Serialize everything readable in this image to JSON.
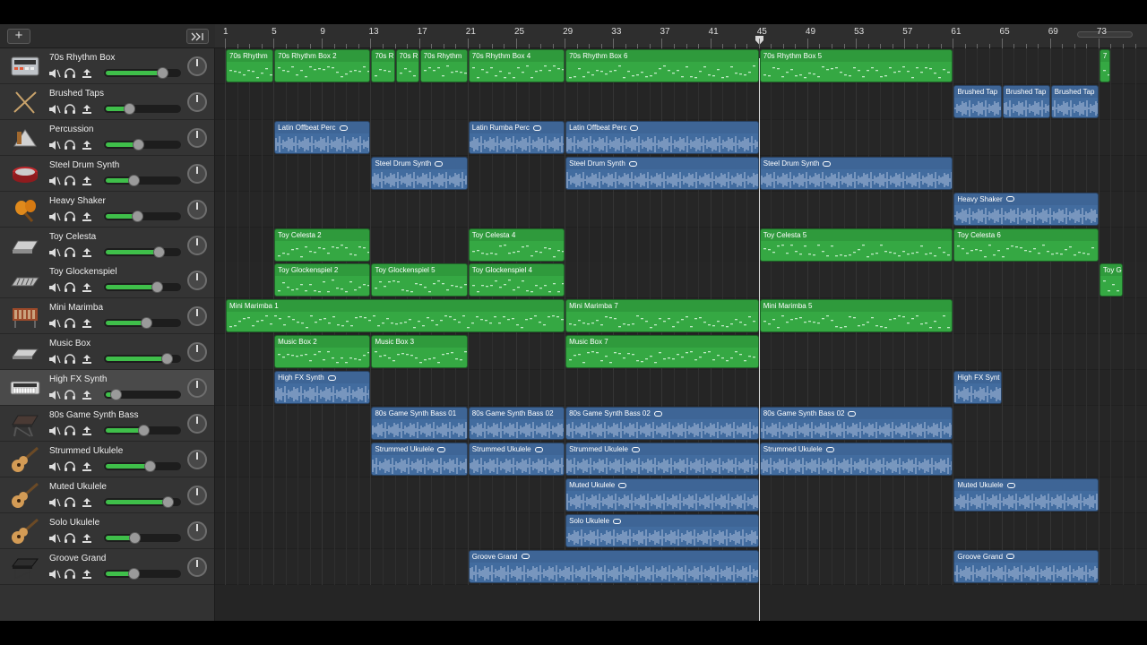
{
  "app": {
    "add_label": "+",
    "accent": "#3fbf4a"
  },
  "ruler": {
    "bars": [
      "1",
      "5",
      "9",
      "13",
      "17",
      "21",
      "25",
      "29",
      "33",
      "37",
      "41",
      "45",
      "49",
      "53",
      "57",
      "61",
      "65",
      "69",
      "73"
    ]
  },
  "tracks": [
    {
      "name": "70s Rhythm Box",
      "icon": "drum-machine-icon",
      "volume": 0.78,
      "selected": false
    },
    {
      "name": "Brushed Taps",
      "icon": "drumsticks-icon",
      "volume": 0.31,
      "selected": false
    },
    {
      "name": "Percussion",
      "icon": "percussion-icon",
      "volume": 0.44,
      "selected": false
    },
    {
      "name": "Steel Drum Synth",
      "icon": "steel-drum-icon",
      "volume": 0.38,
      "selected": false
    },
    {
      "name": "Heavy Shaker",
      "icon": "shaker-icon",
      "volume": 0.42,
      "selected": false
    },
    {
      "name": "Toy Celesta",
      "icon": "keyboard-icon",
      "volume": 0.72,
      "selected": false
    },
    {
      "name": "Toy Glockenspiel",
      "icon": "glockenspiel-icon",
      "volume": 0.7,
      "selected": false
    },
    {
      "name": "Mini Marimba",
      "icon": "marimba-icon",
      "volume": 0.55,
      "selected": false
    },
    {
      "name": "Music Box",
      "icon": "music-box-icon",
      "volume": 0.84,
      "selected": false
    },
    {
      "name": "High FX Synth",
      "icon": "synth-icon",
      "volume": 0.12,
      "selected": true
    },
    {
      "name": "80s Game Synth Bass",
      "icon": "synth-keyboard-icon",
      "volume": 0.51,
      "selected": false
    },
    {
      "name": "Strummed Ukulele",
      "icon": "ukulele-icon",
      "volume": 0.6,
      "selected": false
    },
    {
      "name": "Muted Ukulele",
      "icon": "ukulele-icon",
      "volume": 0.85,
      "selected": false
    },
    {
      "name": "Solo Ukulele",
      "icon": "ukulele-icon",
      "volume": 0.39,
      "selected": false
    },
    {
      "name": "Groove Grand",
      "icon": "piano-icon",
      "volume": 0.37,
      "selected": false
    }
  ],
  "regions": [
    {
      "track": 0,
      "type": "midi",
      "label": "70s Rhythm",
      "start": 1,
      "end": 5
    },
    {
      "track": 0,
      "type": "midi",
      "label": "70s Rhythm Box 2",
      "start": 5,
      "end": 13
    },
    {
      "track": 0,
      "type": "midi",
      "label": "70s R",
      "start": 13,
      "end": 15
    },
    {
      "track": 0,
      "type": "midi",
      "label": "70s R",
      "start": 15,
      "end": 17
    },
    {
      "track": 0,
      "type": "midi",
      "label": "70s Rhythm",
      "start": 17,
      "end": 21
    },
    {
      "track": 0,
      "type": "midi",
      "label": "70s Rhythm Box 4",
      "start": 21,
      "end": 29
    },
    {
      "track": 0,
      "type": "midi",
      "label": "70s Rhythm Box 6",
      "start": 29,
      "end": 45
    },
    {
      "track": 0,
      "type": "midi",
      "label": "70s Rhythm Box 5",
      "start": 45,
      "end": 61
    },
    {
      "track": 0,
      "type": "midi",
      "label": "7",
      "start": 73,
      "end": 74
    },
    {
      "track": 1,
      "type": "audio",
      "label": "Brushed Tap",
      "start": 61,
      "end": 65
    },
    {
      "track": 1,
      "type": "audio",
      "label": "Brushed Tap",
      "start": 65,
      "end": 69
    },
    {
      "track": 1,
      "type": "audio",
      "label": "Brushed Tap",
      "start": 69,
      "end": 73
    },
    {
      "track": 2,
      "type": "audio",
      "label": "Latin Offbeat Perc",
      "start": 5,
      "end": 13,
      "loop": true
    },
    {
      "track": 2,
      "type": "audio",
      "label": "Latin Rumba Perc",
      "start": 21,
      "end": 29,
      "loop": true
    },
    {
      "track": 2,
      "type": "audio",
      "label": "Latin Offbeat Perc",
      "start": 29,
      "end": 45,
      "loop": true
    },
    {
      "track": 3,
      "type": "audio",
      "label": "Steel Drum Synth",
      "start": 13,
      "end": 21,
      "loop": true
    },
    {
      "track": 3,
      "type": "audio",
      "label": "Steel Drum Synth",
      "start": 29,
      "end": 45,
      "loop": true
    },
    {
      "track": 3,
      "type": "audio",
      "label": "Steel Drum Synth",
      "start": 45,
      "end": 61,
      "loop": true
    },
    {
      "track": 4,
      "type": "audio",
      "label": "Heavy Shaker",
      "start": 61,
      "end": 73,
      "loop": true
    },
    {
      "track": 5,
      "type": "midi",
      "label": "Toy Celesta 2",
      "start": 5,
      "end": 13
    },
    {
      "track": 5,
      "type": "midi",
      "label": "Toy Celesta 4",
      "start": 21,
      "end": 29
    },
    {
      "track": 5,
      "type": "midi",
      "label": "Toy Celesta 5",
      "start": 45,
      "end": 61
    },
    {
      "track": 5,
      "type": "midi",
      "label": "Toy Celesta 6",
      "start": 61,
      "end": 73
    },
    {
      "track": 6,
      "type": "midi",
      "label": "Toy Glockenspiel 2",
      "start": 5,
      "end": 13
    },
    {
      "track": 6,
      "type": "midi",
      "label": "Toy Glockenspiel 5",
      "start": 13,
      "end": 21
    },
    {
      "track": 6,
      "type": "midi",
      "label": "Toy Glockenspiel 4",
      "start": 21,
      "end": 29
    },
    {
      "track": 6,
      "type": "midi",
      "label": "Toy G",
      "start": 73,
      "end": 75
    },
    {
      "track": 7,
      "type": "midi",
      "label": "Mini Marimba 1",
      "start": 1,
      "end": 29
    },
    {
      "track": 7,
      "type": "midi",
      "label": "Mini Marimba 7",
      "start": 29,
      "end": 45
    },
    {
      "track": 7,
      "type": "midi",
      "label": "Mini Marimba 5",
      "start": 45,
      "end": 61
    },
    {
      "track": 8,
      "type": "midi",
      "label": "Music Box 2",
      "start": 5,
      "end": 13
    },
    {
      "track": 8,
      "type": "midi",
      "label": "Music Box 3",
      "start": 13,
      "end": 21
    },
    {
      "track": 8,
      "type": "midi",
      "label": "Music Box 7",
      "start": 29,
      "end": 45
    },
    {
      "track": 9,
      "type": "audio",
      "label": "High FX Synth",
      "start": 5,
      "end": 13,
      "loop": true
    },
    {
      "track": 9,
      "type": "audio",
      "label": "High FX Synt",
      "start": 61,
      "end": 65
    },
    {
      "track": 10,
      "type": "audio",
      "label": "80s Game Synth Bass 01",
      "start": 13,
      "end": 21
    },
    {
      "track": 10,
      "type": "audio",
      "label": "80s Game Synth Bass 02",
      "start": 21,
      "end": 29
    },
    {
      "track": 10,
      "type": "audio",
      "label": "80s Game Synth Bass 02",
      "start": 29,
      "end": 45,
      "loop": true
    },
    {
      "track": 10,
      "type": "audio",
      "label": "80s Game Synth Bass 02",
      "start": 45,
      "end": 61,
      "loop": true
    },
    {
      "track": 11,
      "type": "audio",
      "label": "Strummed Ukulele",
      "start": 13,
      "end": 21,
      "loop": true
    },
    {
      "track": 11,
      "type": "audio",
      "label": "Strummed Ukulele",
      "start": 21,
      "end": 29,
      "loop": true
    },
    {
      "track": 11,
      "type": "audio",
      "label": "Strummed Ukulele",
      "start": 29,
      "end": 45,
      "loop": true
    },
    {
      "track": 11,
      "type": "audio",
      "label": "Strummed Ukulele",
      "start": 45,
      "end": 61,
      "loop": true
    },
    {
      "track": 12,
      "type": "audio",
      "label": "Muted Ukulele",
      "start": 29,
      "end": 45,
      "loop": true
    },
    {
      "track": 12,
      "type": "audio",
      "label": "Muted Ukulele",
      "start": 61,
      "end": 73,
      "loop": true
    },
    {
      "track": 13,
      "type": "audio",
      "label": "Solo Ukulele",
      "start": 29,
      "end": 45,
      "loop": true
    },
    {
      "track": 14,
      "type": "audio",
      "label": "Groove Grand",
      "start": 21,
      "end": 45,
      "loop": true
    },
    {
      "track": 14,
      "type": "audio",
      "label": "Groove Grand",
      "start": 61,
      "end": 73,
      "loop": true
    }
  ],
  "playhead_bar": 45
}
